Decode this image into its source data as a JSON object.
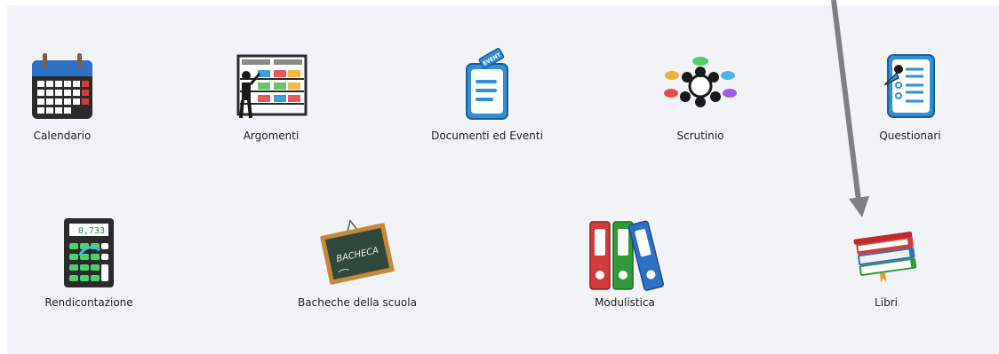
{
  "tiles": [
    {
      "label": "Calendario",
      "icon": "calendar-icon"
    },
    {
      "label": "Argomenti",
      "icon": "teacher-board-icon"
    },
    {
      "label": "Documenti ed Eventi",
      "icon": "documents-events-icon",
      "badge": "EVENT"
    },
    {
      "label": "Scrutinio",
      "icon": "meeting-icon"
    },
    {
      "label": "Questionari",
      "icon": "questionnaire-icon"
    },
    {
      "label": "Rendicontazione",
      "icon": "calculator-icon",
      "display": "0,733"
    },
    {
      "label": "Bacheche della scuola",
      "icon": "chalkboard-icon",
      "board_text": "BACHECA"
    },
    {
      "label": "Modulistica",
      "icon": "binders-icon"
    },
    {
      "label": "Libri",
      "icon": "books-icon"
    }
  ],
  "annotation": {
    "icon": "annotation-arrow-icon",
    "color": "#808080"
  },
  "colors": {
    "panel": "#f2f3f7",
    "accent_blue": "#2f8fd8"
  }
}
